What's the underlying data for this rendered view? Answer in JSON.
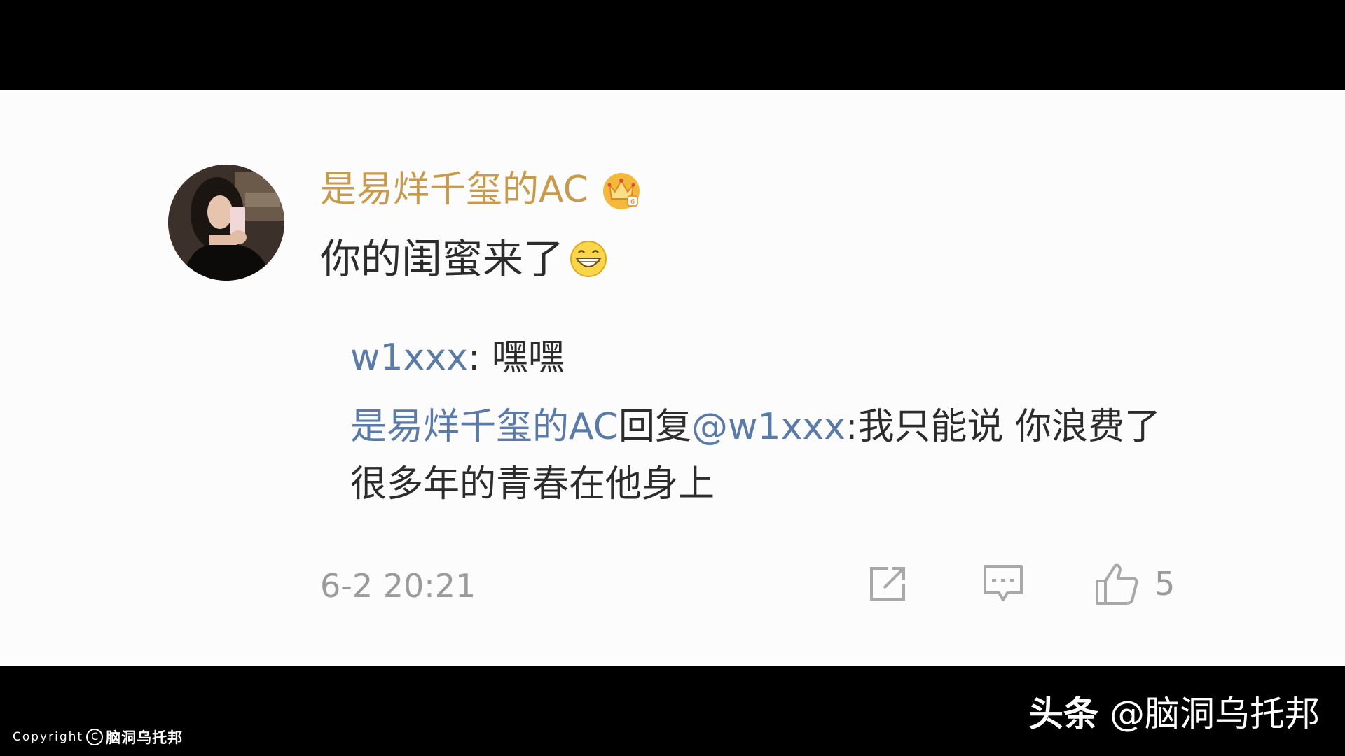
{
  "comment": {
    "username": "是易烊千玺的AC",
    "user_badge_icon": "crown-badge-icon",
    "text": "你的闺蜜来了",
    "text_emoji_icon": "grin-emoji-icon",
    "timestamp": "6-2 20:21",
    "like_count": "5",
    "colors": {
      "username": "#c79a4c",
      "link": "#5a7ba8",
      "text": "#2c2c2c",
      "meta": "#9a9a9a"
    }
  },
  "replies": [
    {
      "author": "w1xxx",
      "separator": ": ",
      "text": "嘿嘿"
    },
    {
      "author": "是易烊千玺的AC",
      "action": "回复",
      "mention": "@w1xxx",
      "text": ":我只能说 你浪费了很多年的青春在他身上"
    }
  ],
  "actions": {
    "share_icon": "share-icon",
    "comment_icon": "comment-icon",
    "like_icon": "thumbs-up-icon"
  },
  "overlay": {
    "copyright_label": "Copyright",
    "copyright_symbol": "C",
    "copyright_brand": "脑洞乌托邦",
    "watermark_app": "头条",
    "watermark_handle": "@脑洞乌托邦"
  }
}
